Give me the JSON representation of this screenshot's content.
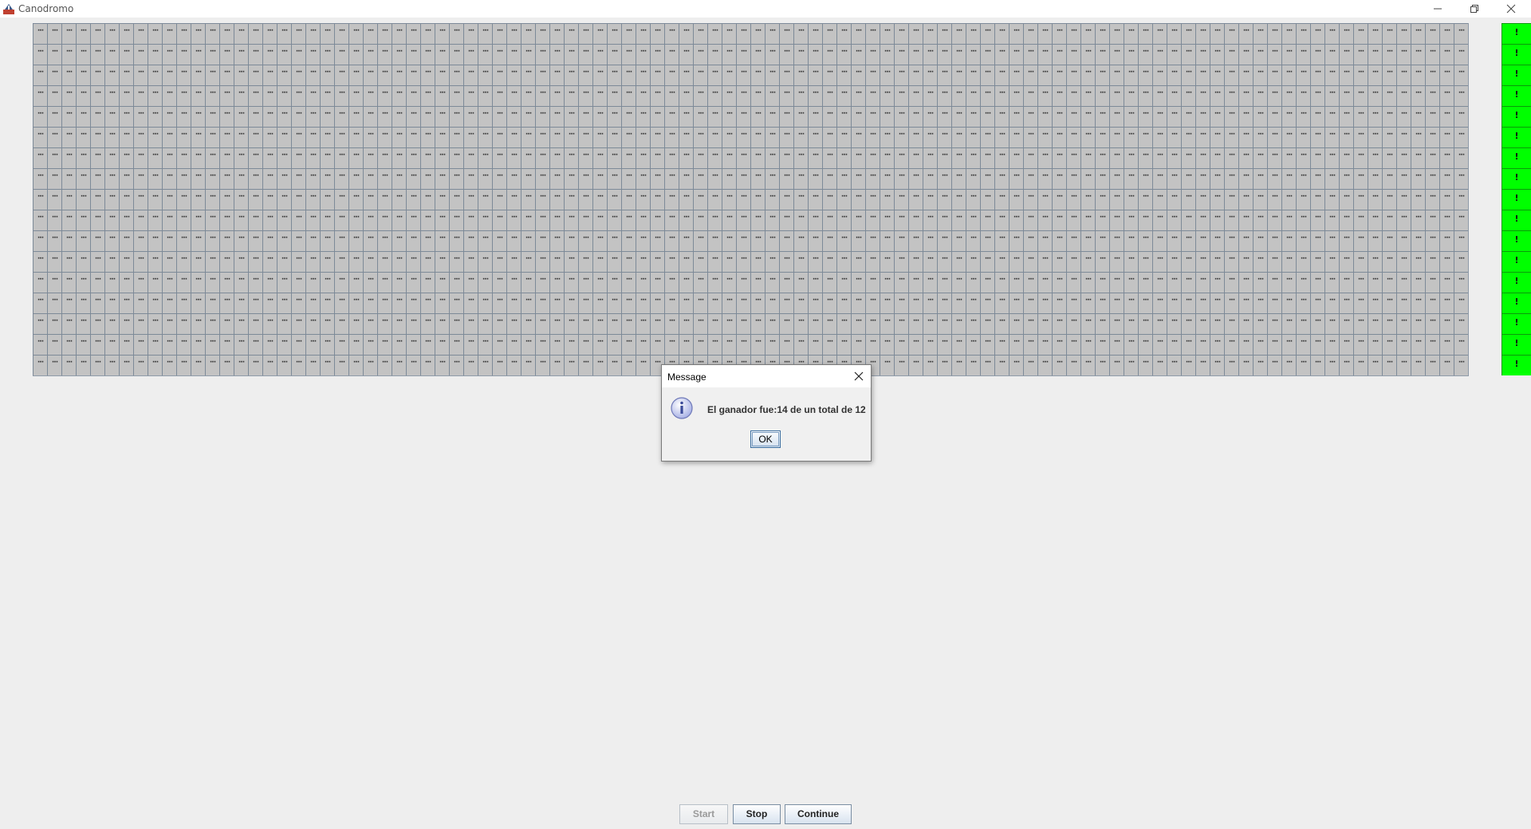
{
  "window": {
    "title": "Canodromo"
  },
  "track": {
    "rows": 17,
    "columns": 100,
    "cell_text": "···",
    "cell_color": "#c3c3c3",
    "finish_text": "!",
    "finish_color": "#00ff00"
  },
  "dialog": {
    "title": "Message",
    "message": "El ganador fue:14 de un total de 12",
    "ok_label": "OK",
    "icon": "info-icon"
  },
  "controls": {
    "start_label": "Start",
    "stop_label": "Stop",
    "continue_label": "Continue",
    "start_enabled": false
  }
}
